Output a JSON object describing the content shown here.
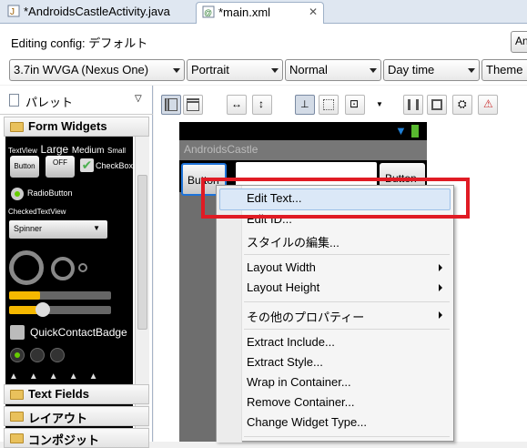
{
  "tabs": [
    {
      "label": "*AndroidsCastleActivity.java",
      "active": false
    },
    {
      "label": "*main.xml",
      "active": true
    }
  ],
  "config": {
    "label": "Editing config: デフォルト",
    "button_label": "An",
    "device": "3.7in WVGA (Nexus One)",
    "orientation": "Portrait",
    "mode": "Normal",
    "time": "Day time",
    "theme": "Theme"
  },
  "palette": {
    "title": "パレット",
    "categories": [
      "Form Widgets",
      "Text Fields",
      "レイアウト",
      "コンポジット"
    ],
    "widgets": {
      "textview": "TextView",
      "large": "Large",
      "medium": "Medium",
      "small": "Small",
      "button": "Button",
      "toggle": "OFF",
      "checkbox": "CheckBox",
      "radio": "RadioButton",
      "checkedtextview": "CheckedTextView",
      "spinner": "Spinner",
      "quickcontact": "QuickContactBadge"
    }
  },
  "device": {
    "app_title": "AndroidsCastle",
    "button_left": "Button",
    "button_right": "Button"
  },
  "menu": {
    "items": [
      {
        "label": "Edit Text...",
        "submenu": false,
        "highlighted": true
      },
      {
        "label": "Edit ID...",
        "submenu": false
      },
      {
        "label": "スタイルの編集...",
        "submenu": false
      },
      {
        "label": "Layout Width",
        "submenu": true
      },
      {
        "label": "Layout Height",
        "submenu": true
      },
      {
        "label": "その他のプロパティー",
        "submenu": true
      },
      {
        "label": "Extract Include...",
        "submenu": false
      },
      {
        "label": "Extract Style...",
        "submenu": false
      },
      {
        "label": "Wrap in Container...",
        "submenu": false
      },
      {
        "label": "Remove Container...",
        "submenu": false
      },
      {
        "label": "Change Widget Type...",
        "submenu": false
      }
    ]
  },
  "colors": {
    "highlight_box": "#e01b24",
    "android_blue": "#1f7fd6"
  }
}
